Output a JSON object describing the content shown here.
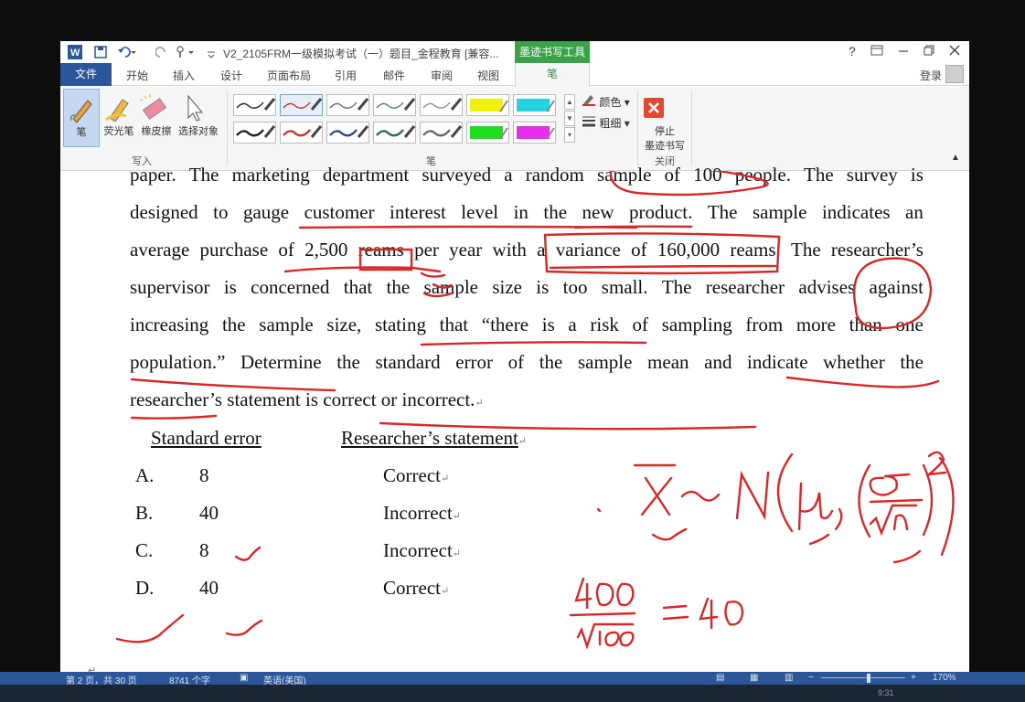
{
  "titlebar": {
    "title": "V2_2105FRM一级模拟考试（一）题目_金程教育 [兼容...",
    "context_tab_title": "墨迹书写工具",
    "help": "?",
    "login": "登录"
  },
  "tabs": {
    "file": "文件",
    "items": [
      "开始",
      "插入",
      "设计",
      "页面布局",
      "引用",
      "邮件",
      "审阅",
      "视图"
    ],
    "active": "笔"
  },
  "ribbon": {
    "write_group": {
      "label": "写入",
      "pen": "笔",
      "highlighter": "荧光笔",
      "eraser": "橡皮擦",
      "select": "选择对象"
    },
    "pens_group": {
      "label": "笔",
      "color": "颜色",
      "weight": "粗细"
    },
    "close_group": {
      "label": "关闭",
      "stop_line1": "停止",
      "stop_line2": "墨迹书写"
    },
    "pen_colors": [
      "#222222",
      "#c0392b",
      "#5f6f80",
      "#4d8a5a",
      "#8d8d8d",
      "#f2f200",
      "#22d3e0",
      "#222222",
      "#c0392b",
      "#2d4f7c",
      "#2d6b5a",
      "#6a6a6a",
      "#1fdd1f",
      "#e82bee"
    ]
  },
  "document": {
    "lines": [
      [
        "paper.",
        "The",
        "marketing",
        "department",
        "surveyed",
        "a",
        "random",
        "sample",
        "of",
        "100",
        "people.",
        "The",
        "survey",
        "is"
      ],
      [
        "designed",
        "to",
        "gauge",
        "customer",
        "interest",
        "level",
        "in",
        "the",
        "new",
        "product.",
        "The",
        "sample",
        "indicates",
        "an"
      ],
      [
        "average",
        "purchase",
        "of",
        "2,500",
        "reams",
        "per",
        "year",
        "with",
        "a",
        "variance",
        "of",
        "160,000",
        "reams.",
        "The",
        "researcher’s"
      ],
      [
        "supervisor",
        "is",
        "concerned",
        "that",
        "the",
        "sample",
        "size",
        "is",
        "too",
        "small.",
        "The",
        "researcher",
        "advises",
        "against"
      ],
      [
        "increasing",
        "the",
        "sample",
        "size,",
        "stating",
        "that",
        "“there",
        "is",
        "a",
        "risk",
        "of",
        "sampling",
        "from",
        "more",
        "than",
        "one"
      ],
      [
        "population.”",
        "Determine",
        "the",
        "standard",
        "error",
        "of",
        "the",
        "sample",
        "mean",
        "and",
        "indicate",
        "whether",
        "the"
      ]
    ],
    "last_line": "researcher’s statement is correct or incorrect.",
    "para_mark": "↵",
    "header_col1": "Standard error",
    "header_col2": "Researcher’s statement",
    "options": [
      {
        "letter": "A.",
        "se": "8",
        "statement": "Correct"
      },
      {
        "letter": "B.",
        "se": "40",
        "statement": "Incorrect"
      },
      {
        "letter": "C.",
        "se": "8",
        "statement": "Incorrect"
      },
      {
        "letter": "D.",
        "se": "40",
        "statement": "Correct"
      }
    ]
  },
  "statusbar": {
    "page": "第 2 页，共 30 页",
    "words": "8741 个字",
    "language": "英语(美国)",
    "zoom": "170%",
    "time": "9:31"
  },
  "annotations": {
    "accent_color": "#d62a2a"
  }
}
